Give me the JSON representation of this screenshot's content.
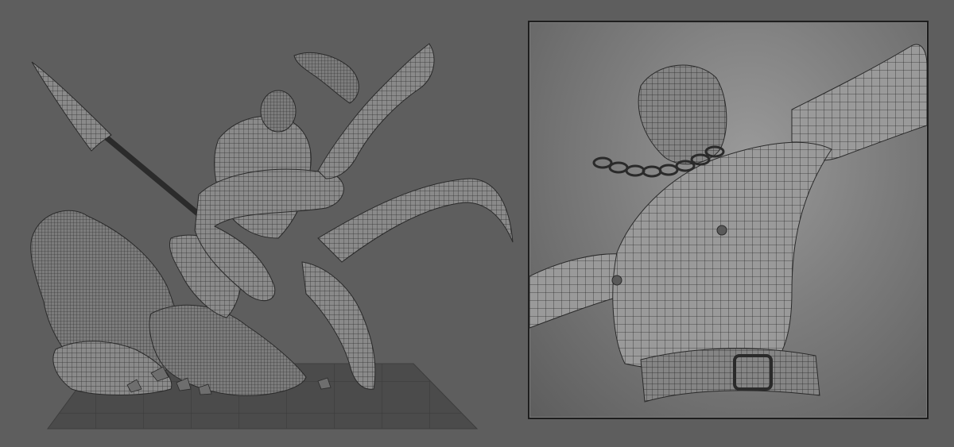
{
  "scene": {
    "left_view": "full-statue-wireframe",
    "right_view": "torso-closeup-wireframe"
  },
  "colors": {
    "background": "#5e5e5e",
    "mesh_dark": "#2a2a2a",
    "mesh_light": "#9c9c9c",
    "floor": "#4a4a4a",
    "panel_border": "#1e1e1e"
  }
}
